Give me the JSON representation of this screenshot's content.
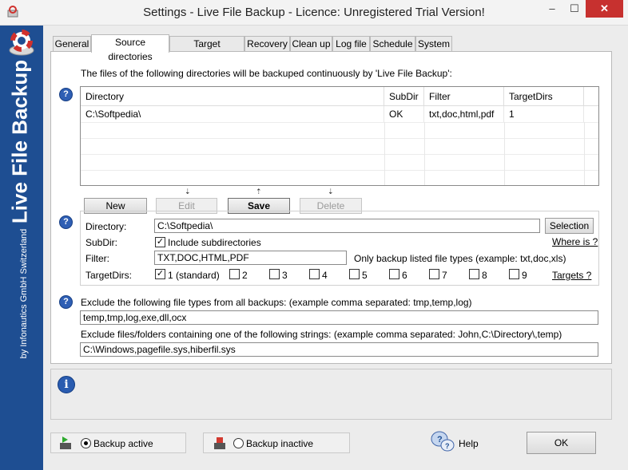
{
  "window": {
    "title": "Settings - Live File Backup - Licence: Unregistered Trial Version!",
    "minimize": "–",
    "maximize": "☐",
    "close": "✕"
  },
  "sidebar": {
    "app_name": "Live File Backup",
    "company": "by Infonautics GmbH Switzerland"
  },
  "tabs": [
    "General",
    "Source directories",
    "Target directories",
    "Recovery",
    "Clean up",
    "Log file",
    "Schedule",
    "System"
  ],
  "active_tab": "Source directories",
  "source": {
    "intro": "The files of the following directories will be backuped continuously by 'Live File Backup':",
    "columns": [
      "Directory",
      "SubDir",
      "Filter",
      "TargetDirs"
    ],
    "rows": [
      {
        "directory": "C:\\Softpedia\\",
        "subdir": "OK",
        "filter": "txt,doc,html,pdf",
        "targetdirs": "1"
      }
    ]
  },
  "buttons": {
    "new": "New",
    "edit": "Edit",
    "save": "Save",
    "delete": "Delete",
    "selection": "Selection",
    "ok": "OK"
  },
  "edit": {
    "directory_label": "Directory:",
    "directory_value": "C:\\Softpedia\\",
    "subdir_label": "SubDir:",
    "subdir_checkbox": "Include subdirectories",
    "filter_label": "Filter:",
    "filter_value": "TXT,DOC,HTML,PDF",
    "filter_hint": "Only backup listed file types  (example: txt,doc,xls)",
    "targetdirs_label": "TargetDirs:",
    "target_first": "1  (standard)",
    "targets": [
      "2",
      "3",
      "4",
      "5",
      "6",
      "7",
      "8",
      "9"
    ],
    "where_link": "Where is ?",
    "targets_link": "Targets ?"
  },
  "exclude": {
    "types_label": "Exclude the following file types from all backups:   (example comma separated: tmp,temp,log)",
    "types_value": "temp,tmp,log,exe,dll,ocx",
    "strings_label": "Exclude files/folders containing one of the following strings:   (example comma separated: John,C:\\Directory\\,temp)",
    "strings_value": "C:\\Windows,pagefile.sys,hiberfil.sys"
  },
  "status": {
    "active": "Backup active",
    "inactive": "Backup inactive",
    "help": "Help"
  }
}
